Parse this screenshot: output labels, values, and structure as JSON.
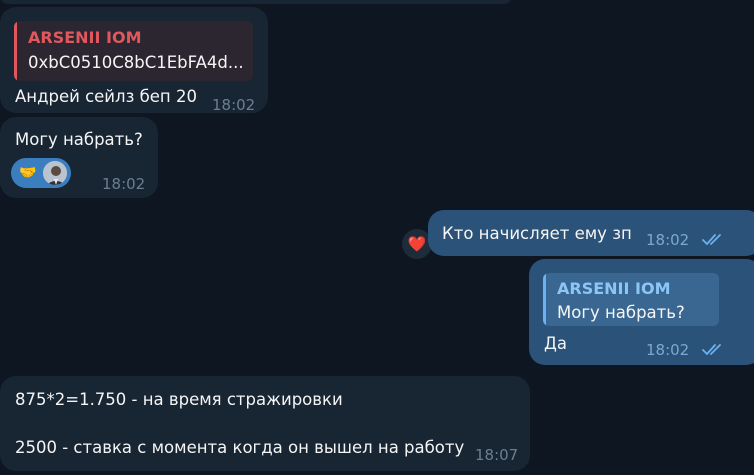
{
  "messages": [
    {
      "direction": "incoming",
      "reply": {
        "author": "ARSENII IOM",
        "text": "0xbC0510C8bC1EbFA4d...",
        "accent_color": "#e0585e"
      },
      "text": "Андрей сейлз беп 20",
      "time": "18:02"
    },
    {
      "direction": "incoming",
      "text": "Могу набрать?",
      "time": "18:02",
      "reaction": {
        "icon": "handshake-icon",
        "emoji": "🤝",
        "reactor": "user-avatar"
      }
    },
    {
      "direction": "outgoing",
      "text": "Кто начисляет ему зп",
      "time": "18:02",
      "status": "read",
      "reaction": {
        "icon": "heart-icon",
        "emoji": "❤️"
      }
    },
    {
      "direction": "outgoing",
      "reply": {
        "author": "ARSENII IOM",
        "text": "Могу набрать?",
        "accent_color": "#6ab2f2"
      },
      "text": "Да",
      "time": "18:02",
      "status": "read"
    },
    {
      "direction": "incoming",
      "lines": [
        "875*2=1.750  - на время стражировки",
        "2500 - ставка с момента когда он вышел на работу"
      ],
      "time": "18:07"
    }
  ],
  "colors": {
    "background": "#0e1621",
    "incoming_bubble": "#182533",
    "outgoing_bubble": "#2b5278",
    "outgoing_time": "#7da8d3",
    "read_checks": "#6ab2f2",
    "incoming_reply_accent": "#e0585e",
    "outgoing_reply_accent": "#6ab2f2"
  }
}
